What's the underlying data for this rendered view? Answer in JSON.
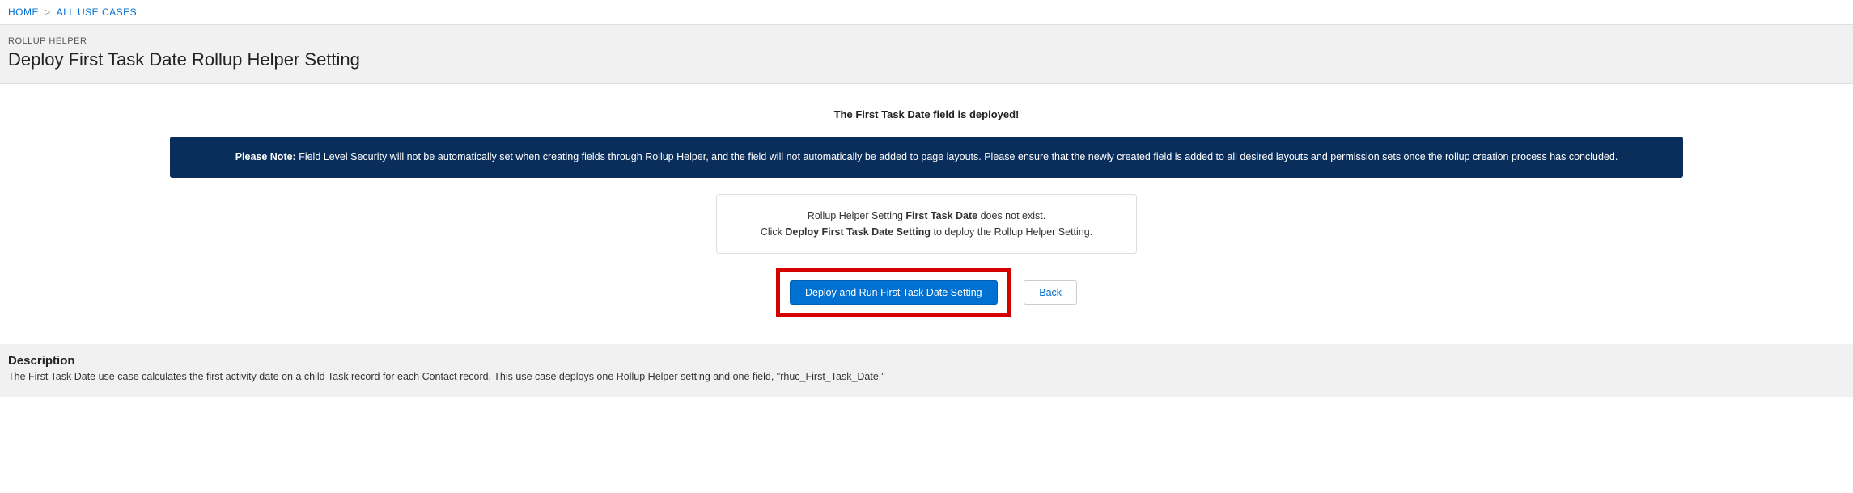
{
  "breadcrumb": {
    "home": "HOME",
    "all_use_cases": "ALL USE CASES"
  },
  "header": {
    "eyebrow": "ROLLUP HELPER",
    "title": "Deploy First Task Date Rollup Helper Setting"
  },
  "status_message": "The First Task Date field is deployed!",
  "notice": {
    "prefix": "Please Note:",
    "body": " Field Level Security will not be automatically set when creating fields through Rollup Helper, and the field will not automatically be added to page layouts. Please ensure that the newly created field is added to all desired layouts and permission sets once the rollup creation process has concluded."
  },
  "instruction": {
    "line1_pre": "Rollup Helper Setting ",
    "line1_bold": "First Task Date",
    "line1_post": " does not exist.",
    "line2_pre": "Click ",
    "line2_bold": "Deploy First Task Date Setting",
    "line2_post": " to deploy the Rollup Helper Setting."
  },
  "buttons": {
    "deploy": "Deploy and Run First Task Date Setting",
    "back": "Back"
  },
  "description": {
    "title": "Description",
    "body": "The First Task Date use case calculates the first activity date on a child Task record for each Contact record. This use case deploys one Rollup Helper setting and one field, \"rhuc_First_Task_Date.\""
  }
}
